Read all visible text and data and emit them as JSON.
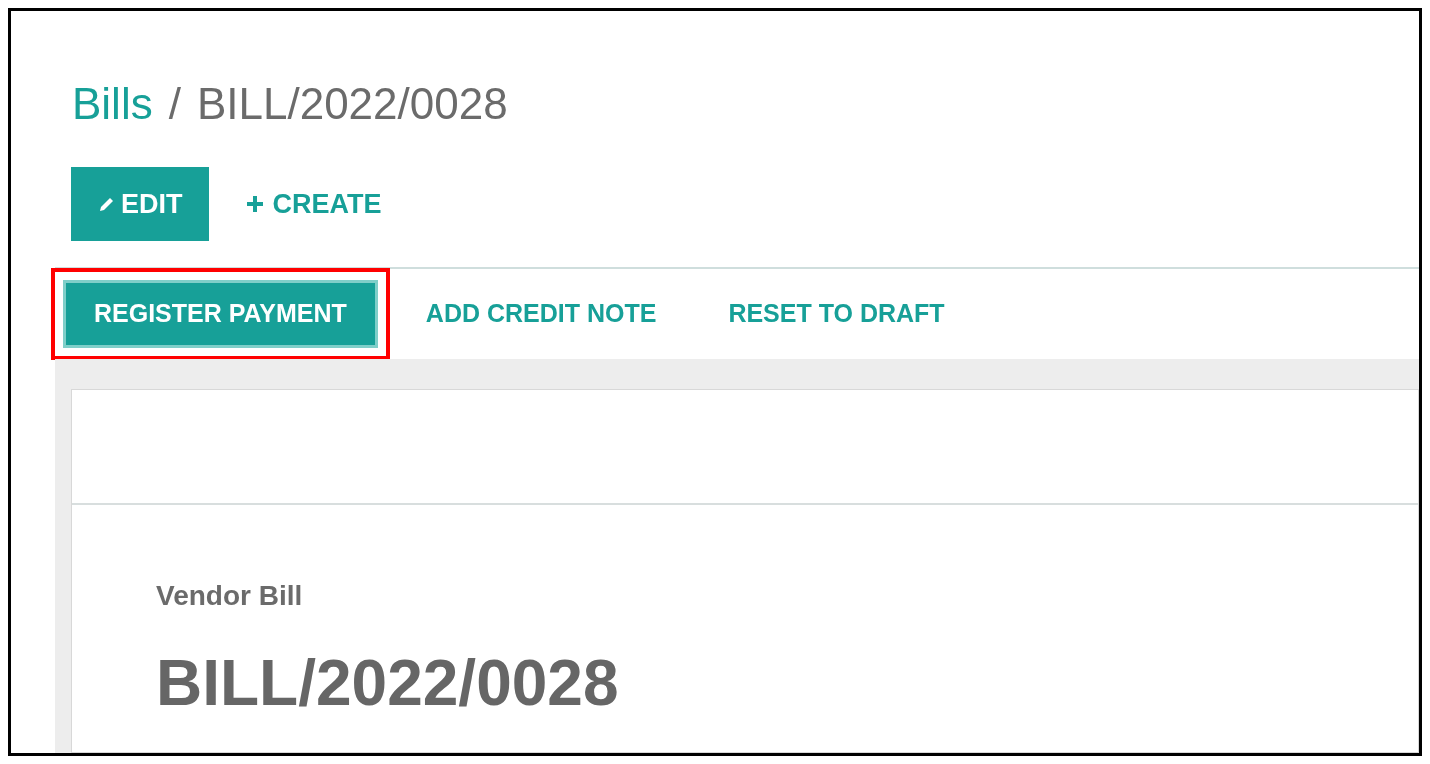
{
  "breadcrumb": {
    "parent": "Bills",
    "separator": "/",
    "current": "BILL/2022/0028"
  },
  "control_buttons": [
    {
      "label": "EDIT",
      "kind": "primary"
    },
    {
      "label": "CREATE",
      "kind": "link"
    }
  ],
  "status_actions": [
    {
      "label": "REGISTER PAYMENT",
      "kind": "primary",
      "highlighted": true
    },
    {
      "label": "ADD CREDIT NOTE",
      "kind": "link",
      "highlighted": false
    },
    {
      "label": "RESET TO DRAFT",
      "kind": "link",
      "highlighted": false
    }
  ],
  "sheet": {
    "document_type": "Vendor Bill",
    "name": "BILL/2022/0028"
  }
}
